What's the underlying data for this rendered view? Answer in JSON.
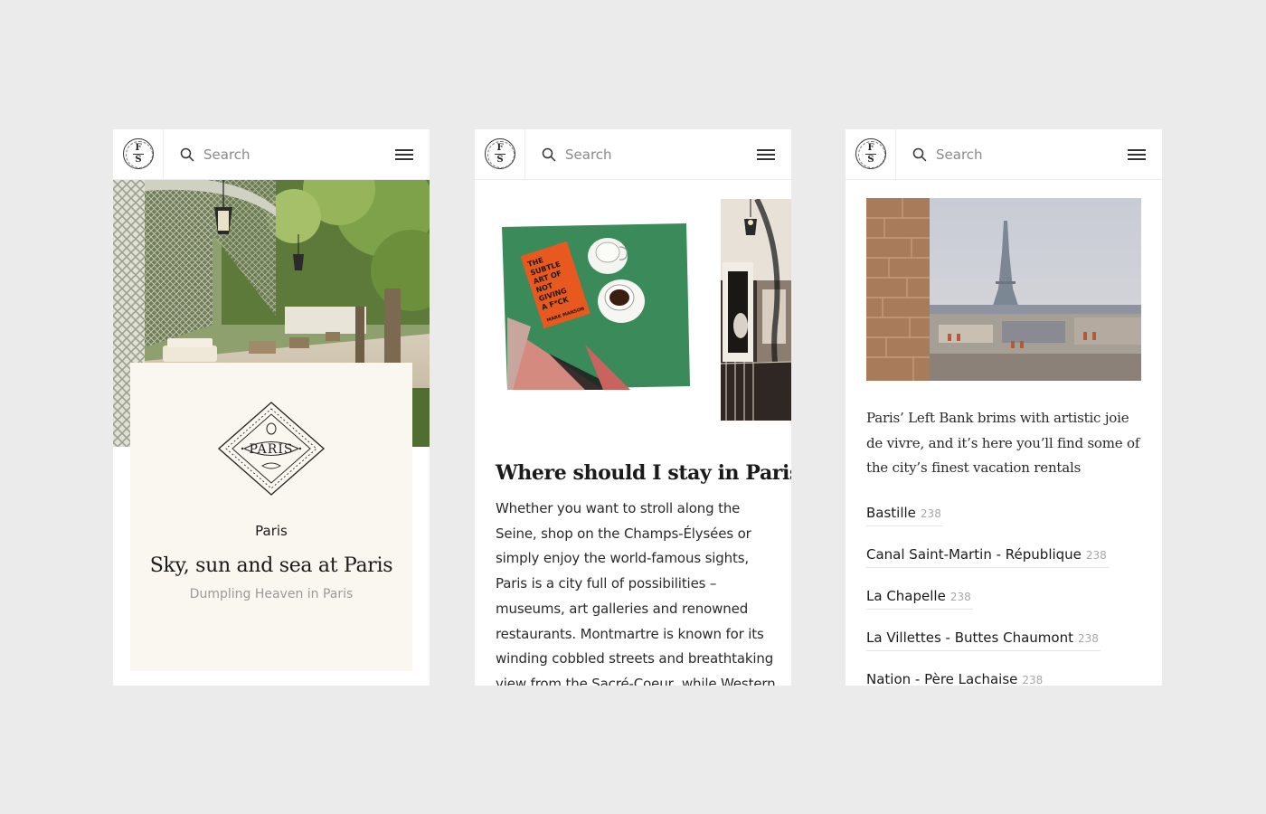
{
  "header": {
    "logo_text_top": "F",
    "logo_text_bottom": "S",
    "search_placeholder": "Search"
  },
  "screen1": {
    "badge_text": "PARIS",
    "place_label": "Paris",
    "title": "Sky, sun and sea at Paris",
    "subtitle": "Dumpling Heaven in Paris"
  },
  "screen2": {
    "book_title_lines": [
      "THE",
      "SUBTLE",
      "ART OF",
      "NOT",
      "GIVING",
      "A F*CK"
    ],
    "book_author": "MARK MANSON",
    "article_title": "Where should I stay in Paris?",
    "article_body": "Whether you want to stroll along the Seine, shop on the Champs-Élysées or simply enjoy the world-famous sights, Paris is a city full of possibilities – museums, art galleries and renowned restaurants. Montmartre is known for its winding cobbled streets and breathtaking view from the Sacré-Coeur, while Western Paris"
  },
  "screen3": {
    "intro_text": "Paris’ Left Bank brims with artistic joie de vivre, and it’s here you’ll find some of the city’s finest vacation rentals",
    "districts": [
      {
        "name": "Bastille",
        "count": "238"
      },
      {
        "name": "Canal Saint-Martin - République",
        "count": "238"
      },
      {
        "name": "La Chapelle",
        "count": "238"
      },
      {
        "name": "La Villettes - Buttes Chaumont",
        "count": "238"
      },
      {
        "name": "Nation - Père Lachaise",
        "count": "238"
      }
    ]
  },
  "colors": {
    "page_background": "#ebebeb",
    "card_background": "#faf7f0",
    "muted_text": "#9a9a9a",
    "count_text": "#a8a8a8"
  },
  "icons": [
    "brand-logo-icon",
    "search-icon",
    "menu-icon",
    "paris-badge-icon"
  ]
}
